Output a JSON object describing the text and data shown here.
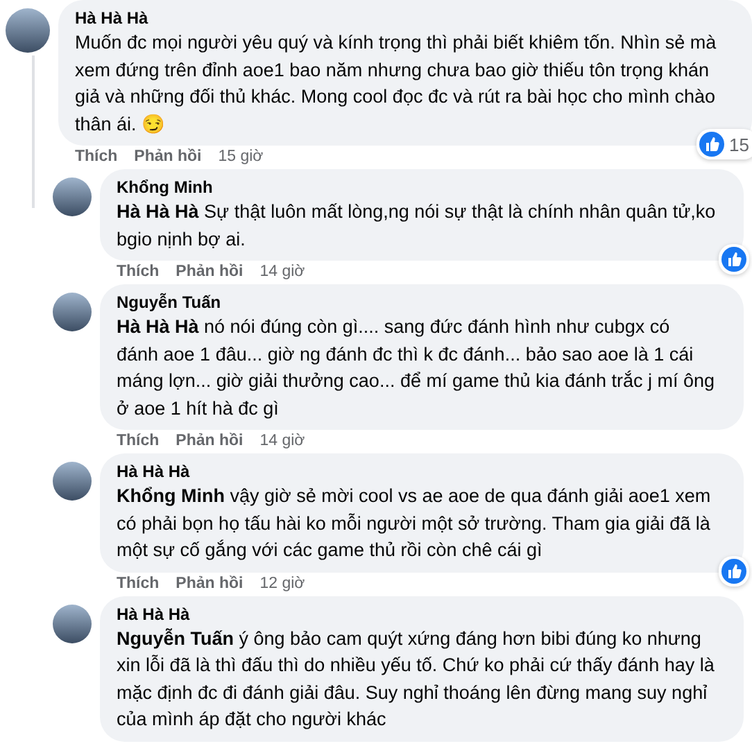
{
  "comment": {
    "author": "Hà Hà Hà",
    "text": "Muốn đc mọi người yêu quý và kính trọng thì phải biết khiêm tốn. Nhìn sẻ mà xem đứng trên đỉnh aoe1 bao năm nhưng chưa bao giờ thiếu tôn trọng khán giả và những đối thủ khác. Mong cool đọc đc và rút ra bài học cho mình chào thân ái. 😏",
    "actions": [
      "Thích",
      "Phản hồi"
    ],
    "time": "15 giờ",
    "liked": true,
    "like_count": "15",
    "children": [
      {
        "author": "Khổng Minh",
        "text": "**Hà Hà Hà** Sự thật luôn mất lòng,ng nói sự thật là chính nhân quân tử,ko bgio nịnh bợ ai.",
        "actions": [
          "Thích",
          "Phản hồi"
        ],
        "time": "14 giờ",
        "liked": true
      },
      {
        "author": "Nguyễn Tuấn",
        "text": "**Hà Hà Hà** nó nói đúng còn gì.... sang đức đánh hình như cubgx có đánh aoe 1 đâu... giờ ng đánh đc thì k đc đánh... bảo sao aoe là 1 cái máng lợn... giờ giải thưởng cao... để mí game thủ kia đánh trắc j mí ông ở aoe 1 hít hà đc gì",
        "actions": [
          "Thích",
          "Phản hồi"
        ],
        "time": "14 giờ",
        "liked": false
      },
      {
        "author": "Hà Hà Hà",
        "text": "**Khổng Minh** vậy giờ sẻ mời cool vs ae aoe de qua đánh giải aoe1 xem có phải bọn họ tấu hài ko mỗi người một sở trường. Tham gia giải đã là một sự cố gắng với các game thủ rồi còn chê cái gì",
        "actions": [
          "Thích",
          "Phản hồi"
        ],
        "time": "12 giờ",
        "liked": true
      },
      {
        "author": "Hà Hà Hà",
        "text": "**Nguyễn Tuấn** ý ông bảo cam quýt xứng đáng hơn bibi đúng ko nhưng xin lỗi đã là thì đấu thì do nhiều yếu tố. Chứ ko phải cứ thấy đánh hay là mặc định đc đi đánh giải đâu. Suy nghỉ thoáng lên đừng mang suy nghỉ của mình áp đặt cho người khác",
        "liked": false
      }
    ]
  }
}
